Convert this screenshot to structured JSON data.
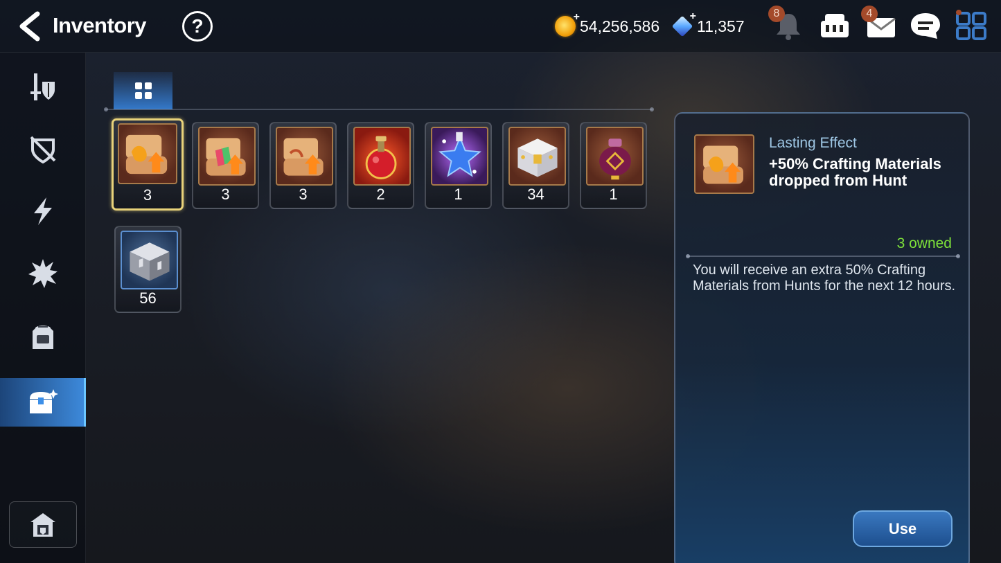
{
  "header": {
    "title": "Inventory",
    "help_label": "?",
    "gold_amount": "54,256,586",
    "gem_amount": "11,357",
    "notifications_badge": "8",
    "mail_badge": "4"
  },
  "sidebar": {
    "items": [
      {
        "name": "equipment",
        "icon": "sword-shield-icon"
      },
      {
        "name": "artifacts",
        "icon": "crossed-shield-icon"
      },
      {
        "name": "catalysts",
        "icon": "lightning-icon"
      },
      {
        "name": "skill-materials",
        "icon": "burst-icon"
      },
      {
        "name": "bags",
        "icon": "backpack-icon"
      },
      {
        "name": "consumables",
        "icon": "treasure-chest-icon",
        "active": true
      }
    ],
    "bottom_icon": "storage-house-icon"
  },
  "tab": {
    "icon": "grid-icon"
  },
  "items": [
    {
      "icon": "scroll-flame-arrow-icon",
      "count": "3",
      "selected": true
    },
    {
      "icon": "scroll-rainbow-arrow-icon",
      "count": "3"
    },
    {
      "icon": "scroll-arrow-icon",
      "count": "3"
    },
    {
      "icon": "red-potion-icon",
      "count": "2"
    },
    {
      "icon": "star-potion-icon",
      "count": "1"
    },
    {
      "icon": "white-chest-icon",
      "count": "34"
    },
    {
      "icon": "purple-urn-icon",
      "count": "1"
    },
    {
      "icon": "silver-cube-icon",
      "count": "56"
    }
  ],
  "detail": {
    "category": "Lasting Effect",
    "effect": "+50% Crafting Materials dropped from Hunt",
    "owned": "3 owned",
    "description": "You will receive an extra 50% Crafting Materials from Hunts for the next 12 hours.",
    "use_label": "Use"
  },
  "colors": {
    "accent_blue": "#3c96ff",
    "owned_green": "#7ee23a",
    "selected_gold": "#e8d27a"
  }
}
